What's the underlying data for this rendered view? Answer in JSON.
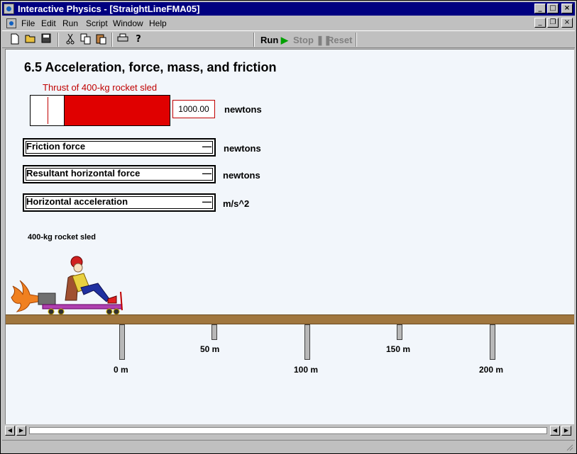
{
  "window": {
    "title": "Interactive Physics - [StraightLineFMA05]",
    "controls": {
      "minimize": "_",
      "maximize": "□",
      "close": "×"
    },
    "doc_controls": {
      "minimize": "_",
      "restore": "❐",
      "close": "×"
    }
  },
  "menu": {
    "items": [
      "File",
      "Edit",
      "Run",
      "Script",
      "Window",
      "Help"
    ]
  },
  "toolbar": {
    "run_label": "Run",
    "stop_label": "Stop",
    "reset_label": "Reset",
    "icons": [
      "new-icon",
      "open-icon",
      "save-icon",
      "cut-icon",
      "copy-icon",
      "paste-icon",
      "print-icon",
      "help-icon"
    ]
  },
  "canvas": {
    "heading": "6.5 Acceleration, force, mass, and friction",
    "thrust": {
      "label": "Thrust of 400-kg rocket sled",
      "value": "1000.00",
      "unit": "newtons",
      "fill_fraction": 0.74
    },
    "meters": [
      {
        "label": "Friction force",
        "value": "—",
        "unit": "newtons"
      },
      {
        "label": "Resultant horizontal force",
        "value": "—",
        "unit": "newtons"
      },
      {
        "label": "Horizontal acceleration",
        "value": "—",
        "unit": "m/s^2"
      }
    ],
    "sled_label": "400-kg rocket sled",
    "distance_marks": [
      "0 m",
      "50 m",
      "100 m",
      "150 m",
      "200 m"
    ]
  },
  "colors": {
    "titlebar": "#000080",
    "thrust_fill": "#e00000",
    "thrust_label": "#c00000",
    "ground": "#a0763e",
    "canvas_bg": "#f2f6fb"
  }
}
